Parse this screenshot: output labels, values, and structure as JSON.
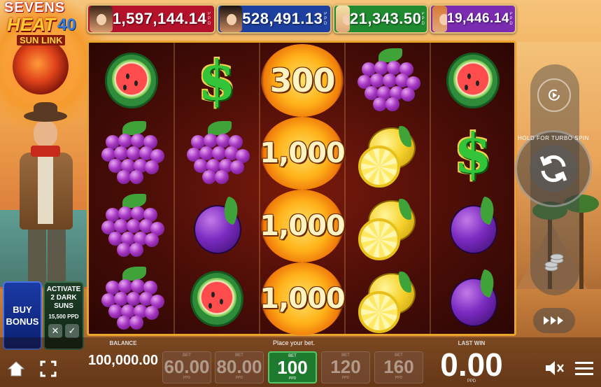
{
  "logo": {
    "line1": "SEVENS",
    "line2": "HEAT",
    "line3": "40",
    "line4": "SUN LINK"
  },
  "jackpots": [
    {
      "amount": "1,597,144.14",
      "currency": "PPD",
      "color": "#b3122a"
    },
    {
      "amount": "528,491.13",
      "currency": "PPD",
      "color": "#1d3f9e"
    },
    {
      "amount": "21,343.50",
      "currency": "PPD",
      "color": "#1f8a2f"
    },
    {
      "amount": "19,446.14",
      "currency": "PPD",
      "color": "#7a2bb0"
    }
  ],
  "reels": [
    [
      "watermelon",
      "grapes",
      "grapes",
      "grapes"
    ],
    [
      "dollar",
      "grapes",
      "plum",
      "watermelon"
    ],
    [
      "sun 300",
      "sun 1,000",
      "sun 1,000",
      "sun 1,000"
    ],
    [
      "grapes",
      "lemon",
      "lemon",
      "lemon"
    ],
    [
      "watermelon",
      "dollar",
      "plum",
      "plum"
    ]
  ],
  "sun_values": {
    "r1": "300",
    "r2": "1,000",
    "r3": "1,000",
    "r4": "1,000"
  },
  "dollar_symbol": "$",
  "buy_bonus": {
    "line1": "BUY",
    "line2": "BONUS"
  },
  "activate": {
    "line1": "ACTIVATE",
    "line2": "2 DARK",
    "line3": "SUNS",
    "price": "15,500 PPD"
  },
  "balance": {
    "label": "BALANCE",
    "value": "100,000.00"
  },
  "place_bet_text": "Place your bet.",
  "bets": [
    {
      "label": "BET",
      "value": "60.00",
      "unit": "PPD",
      "selected": false
    },
    {
      "label": "BET",
      "value": "80.00",
      "unit": "PPD",
      "selected": false
    },
    {
      "label": "BET",
      "value": "100",
      "unit": "PPD",
      "selected": true
    },
    {
      "label": "BET",
      "value": "120",
      "unit": "PPD",
      "selected": false
    },
    {
      "label": "BET",
      "value": "160",
      "unit": "PPD",
      "selected": false
    }
  ],
  "last_win": {
    "label": "LAST WIN",
    "value": "0.00",
    "unit": "PPD"
  },
  "spin": {
    "hold_text": "HOLD FOR TURBO SPIN"
  },
  "icons": {
    "home": "home-icon",
    "fullscreen": "fullscreen-icon",
    "autoplay": "autoplay-icon",
    "spin": "spin-icon",
    "coins": "coins-icon",
    "turbo": "turbo-icon",
    "mute": "mute-icon",
    "menu": "menu-icon"
  }
}
